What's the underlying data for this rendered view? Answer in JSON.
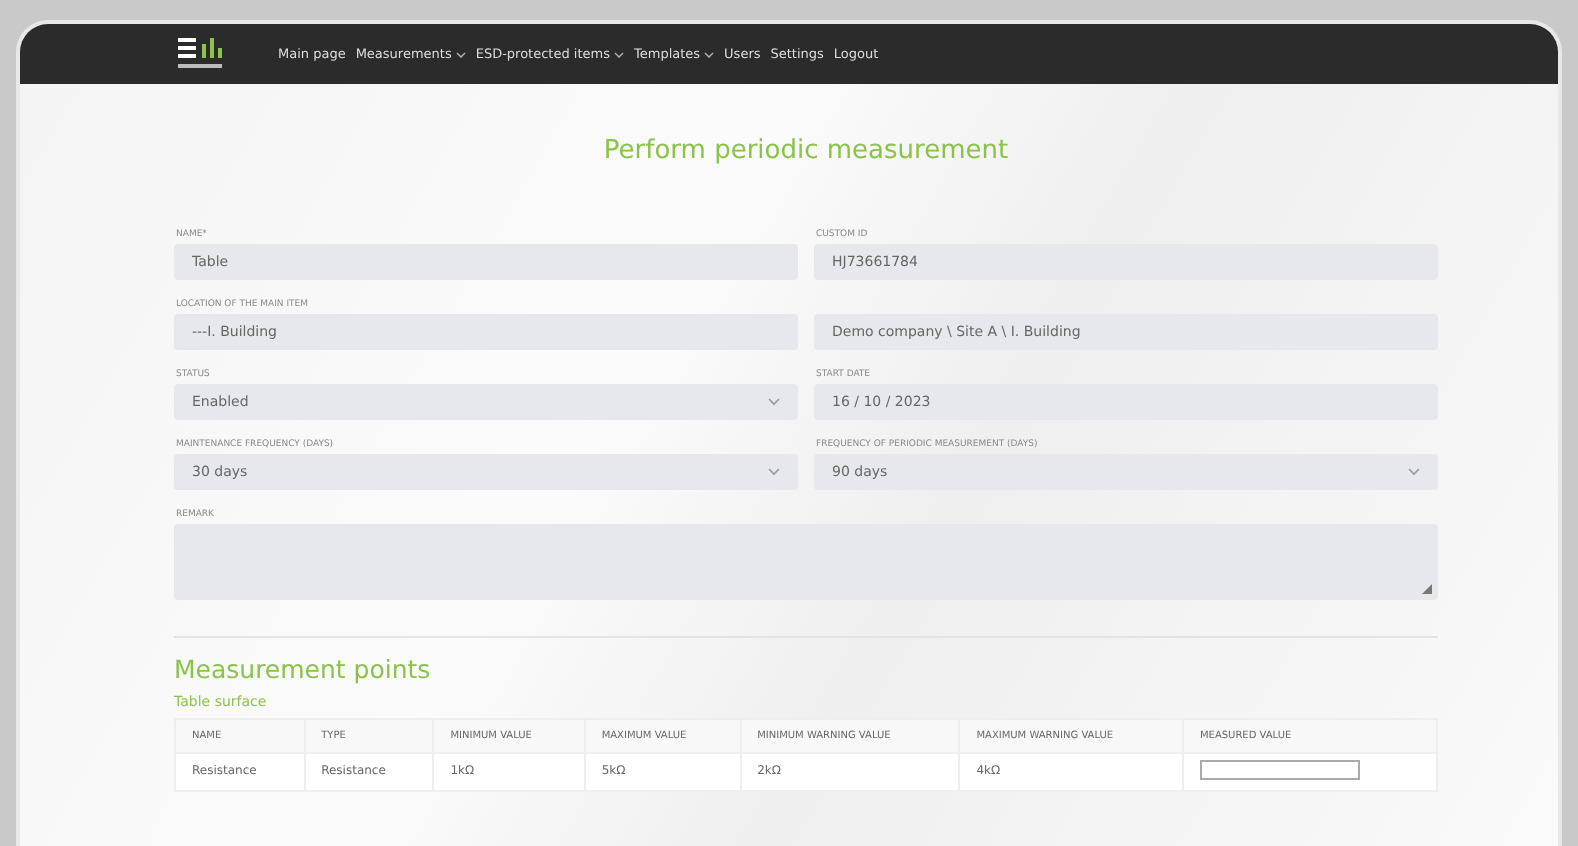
{
  "nav": {
    "items": [
      {
        "label": "Main page",
        "dropdown": false
      },
      {
        "label": "Measurements",
        "dropdown": true
      },
      {
        "label": "ESD-protected items",
        "dropdown": true
      },
      {
        "label": "Templates",
        "dropdown": true
      },
      {
        "label": "Users",
        "dropdown": false
      },
      {
        "label": "Settings",
        "dropdown": false
      },
      {
        "label": "Logout",
        "dropdown": false
      }
    ]
  },
  "title": "Perform periodic measurement",
  "fields": [
    {
      "label": "NAME*",
      "kind": "text",
      "value": "Table"
    },
    {
      "label": "CUSTOM ID",
      "kind": "text",
      "value": "HJ73661784"
    },
    {
      "label": "LOCATION OF THE MAIN ITEM",
      "kind": "text",
      "value": "---I. Building"
    },
    {
      "kind": "text",
      "value": "Demo company \\ Site A \\ I. Building"
    },
    {
      "label": "STATUS",
      "kind": "select",
      "value": "Enabled"
    },
    {
      "label": "START DATE",
      "kind": "text",
      "value": "16 / 10 / 2023"
    },
    {
      "label": "MAINTENANCE FREQUENCY (DAYS)",
      "kind": "select",
      "value": "30 days"
    },
    {
      "label": "FREQUENCY OF PERIODIC MEASUREMENT (DAYS)",
      "kind": "select",
      "value": "90 days"
    },
    {
      "label": "REMARK",
      "kind": "textarea"
    }
  ],
  "measurement_points": {
    "heading": "Measurement points",
    "group": "Table surface",
    "table": {
      "columns": [
        "NAME",
        "TYPE",
        "MINIMUM VALUE",
        "MAXIMUM VALUE",
        "MINIMUM WARNING VALUE",
        "MAXIMUM WARNING VALUE",
        "MEASURED VALUE"
      ],
      "rows": [
        {
          "cells": [
            "Resistance",
            "Resistance",
            "1kΩ",
            "5kΩ",
            "2kΩ",
            "4kΩ"
          ]
        }
      ]
    }
  }
}
